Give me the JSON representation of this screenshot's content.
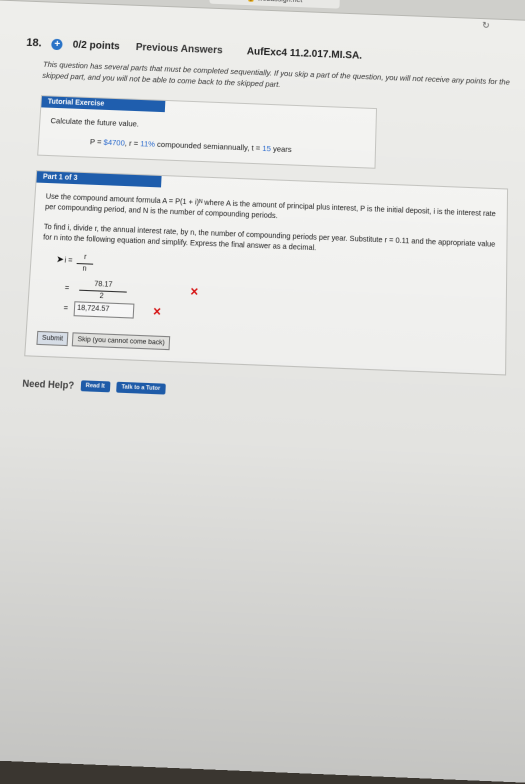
{
  "browser": {
    "url": "🔒 webassign.net"
  },
  "question": {
    "number": "18.",
    "points": "0/2 points",
    "previous_answers": "Previous Answers",
    "code": "AufExc4 11.2.017.MI.SA.",
    "notice": "This question has several parts that must be completed sequentially. If you skip a part of the question, you will not receive any points for the skipped part, and you will not be able to come back to the skipped part."
  },
  "tutorial": {
    "title": "Tutorial Exercise",
    "prompt": "Calculate the future value.",
    "given_prefix": "P = ",
    "given_p": "$4700",
    "given_mid": ", r = ",
    "given_r": "11%",
    "given_comp": " compounded semiannually, t = ",
    "given_t": "15",
    "given_suffix": " years"
  },
  "part": {
    "title": "Part 1 of 3",
    "para1": "Use the compound amount formula A = P(1 + i)ᴺ where A is the amount of principal plus interest, P is the initial deposit, i is the interest rate per compounding period, and N is the number of compounding periods.",
    "para2": "To find i, divide r, the annual interest rate, by n, the number of compounding periods per year. Substitute r = 0.11 and the appropriate value for n into the following equation and simplify. Express the final answer as a decimal.",
    "formula_lhs": "i =",
    "formula_num": "r",
    "formula_den": "n",
    "answer1": "78.17",
    "answer1_den": "2",
    "answer2": "18,724.57",
    "eq": "=",
    "submit_label": "Submit",
    "skip_label": "Skip (you cannot come back)"
  },
  "help": {
    "label": "Need Help?",
    "read_label": "Read It",
    "talk_label": "Talk to a Tutor"
  }
}
